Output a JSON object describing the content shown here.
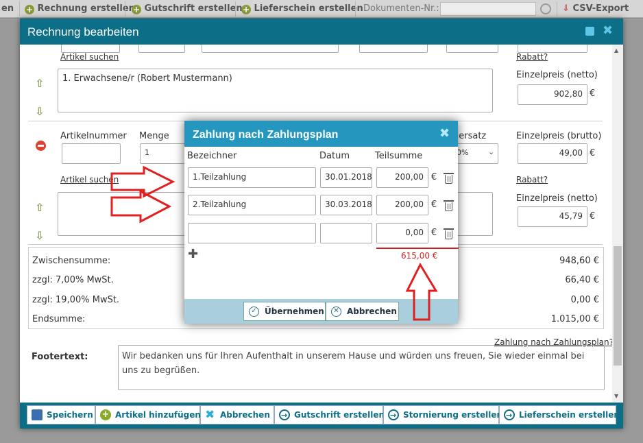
{
  "bg_toolbar": {
    "items": [
      {
        "label": "en"
      },
      {
        "label": "Rechnung erstellen"
      },
      {
        "label": "Gutschrift erstellen"
      },
      {
        "label": "Lieferschein erstellen"
      }
    ],
    "doc_nr_label": "Dokumenten-Nr.:",
    "csv_label": "CSV-Export"
  },
  "dialog": {
    "title": "Rechnung bearbeiten",
    "article_search_link": "Artikel suchen",
    "rabatt_link": "Rabatt?",
    "row1": {
      "description": "1. Erwachsene/r (Robert Mustermann)",
      "netto_label": "Einzelpreis (netto)",
      "netto_value": "902,80",
      "currency": "€"
    },
    "row2": {
      "artikelnummer_label": "Artikelnummer",
      "menge_label": "Menge",
      "menge_value": "1",
      "steuersatz_label": "uersatz",
      "steuersatz_value": "0%",
      "brutto_label": "Einzelpreis (brutto)",
      "brutto_value": "49,00",
      "article_search_link": "Artikel suchen",
      "rabatt_link": "Rabatt?",
      "netto_label": "Einzelpreis (netto)",
      "netto_value": "45,79",
      "currency": "€"
    },
    "totals": [
      {
        "label": "Zwischensumme:",
        "value": "948,60 €"
      },
      {
        "label": "zzgl: 7,00% MwSt.",
        "value": "66,40 €"
      },
      {
        "label": "zzgl: 19,00% MwSt.",
        "value": "0,00 €"
      },
      {
        "label": "Endsumme:",
        "value": "1.015,00 €"
      }
    ],
    "zahlungsplan_link": "Zahlung nach Zahlungsplan?",
    "footer_label": "Footertext:",
    "footer_text": "Wir bedanken uns für Ihren Aufenthalt in unserem Hause und würden uns freuen, Sie wieder einmal bei uns zu begrüßen."
  },
  "buttons": {
    "save": "Speichern",
    "add_article": "Artikel hinzufügen",
    "cancel": "Abbrechen",
    "credit_note": "Gutschrift erstellen",
    "cancellation": "Stornierung erstellen",
    "delivery_note": "Lieferschein erstellen"
  },
  "modal": {
    "title": "Zahlung nach Zahlungsplan",
    "col_name": "Bezeichner",
    "col_date": "Datum",
    "col_amount": "Teilsumme",
    "currency": "€",
    "rows": [
      {
        "name": "1.Teilzahlung",
        "date": "30.01.2018",
        "amount": "200,00"
      },
      {
        "name": "2.Teilzahlung",
        "date": "30.03.2018",
        "amount": "200,00"
      },
      {
        "name": "",
        "date": "",
        "amount": "0,00"
      }
    ],
    "total": "615,00 €",
    "apply_button": "Übernehmen",
    "cancel_button": "Abbrechen"
  },
  "colors": {
    "header_teal": "#0d6e87",
    "modal_blue": "#2596be",
    "annotation_red": "#e02020",
    "total_red": "#d42020"
  }
}
